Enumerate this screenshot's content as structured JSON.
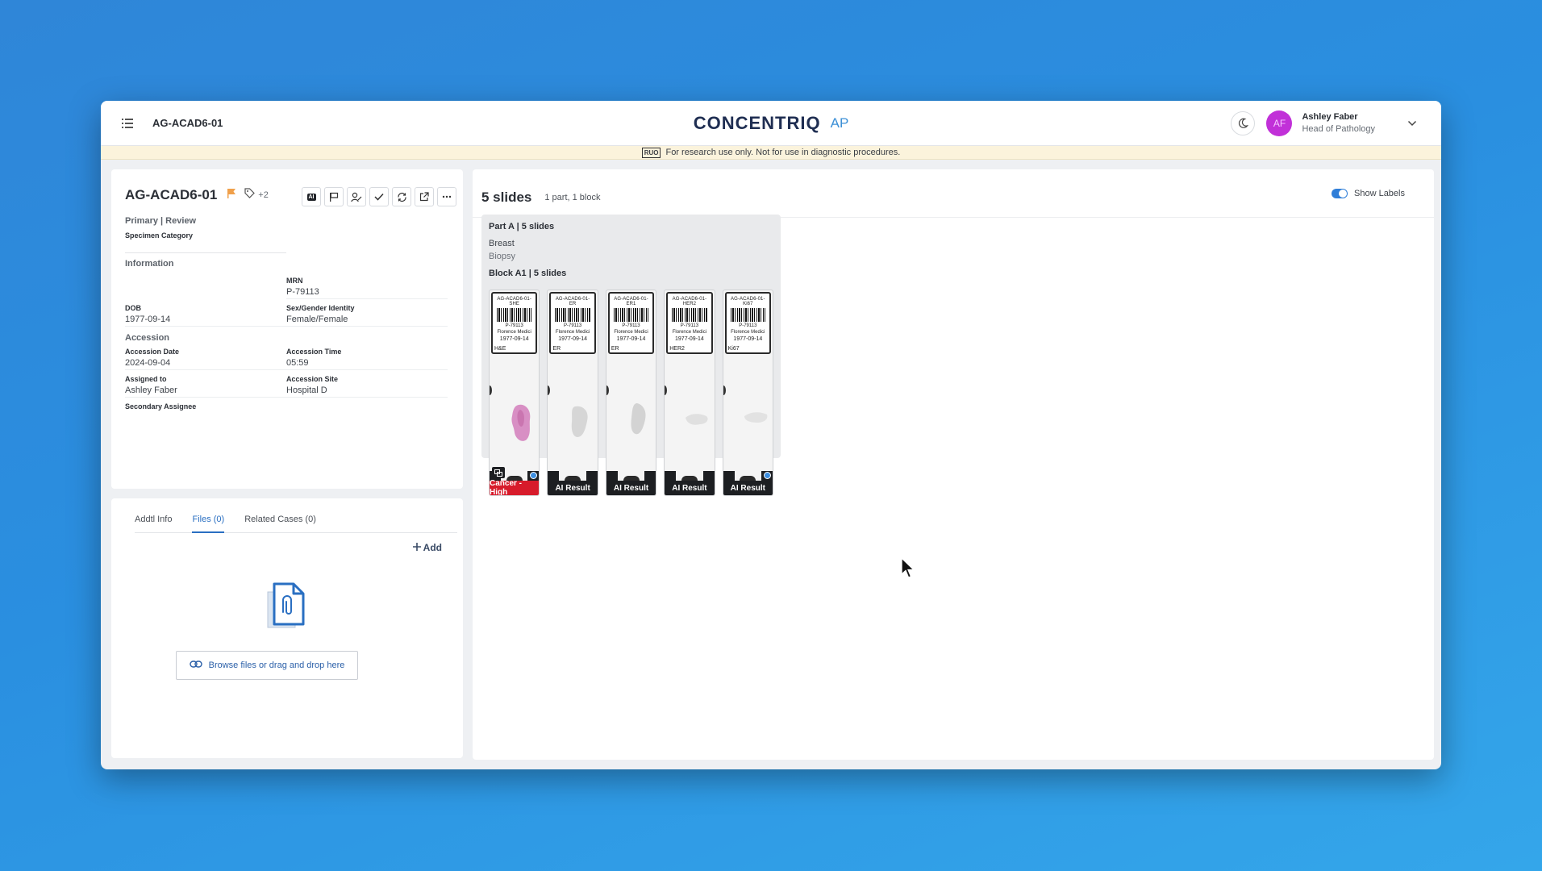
{
  "topbar": {
    "case_title": "AG-ACAD6-01",
    "logo_text": "CONCENTRIQ",
    "logo_suffix": "AP",
    "user_initials": "AF",
    "user_name": "Ashley Faber",
    "user_role": "Head of Pathology"
  },
  "banner": {
    "badge": "RUO",
    "text": "For research use only. Not for use in diagnostic procedures."
  },
  "case": {
    "id": "AG-ACAD6-01",
    "tag_count": "+2",
    "ai_badge": "AI",
    "status": "Primary | Review",
    "specimen_category_label": "Specimen Category",
    "information_title": "Information",
    "mrn_label": "MRN",
    "mrn": "P-79113",
    "dob_label": "DOB",
    "dob": "1977-09-14",
    "sex_label": "Sex/Gender Identity",
    "sex": "Female/Female",
    "accession_title": "Accession",
    "accession_date_label": "Accession Date",
    "accession_date": "2024-09-04",
    "accession_time_label": "Accession Time",
    "accession_time": "05:59",
    "assigned_label": "Assigned to",
    "assigned": "Ashley Faber",
    "site_label": "Accession Site",
    "site": "Hospital D",
    "secondary_label": "Secondary Assignee"
  },
  "files": {
    "tabs": [
      {
        "label": "Addtl Info"
      },
      {
        "label": "Files (0)"
      },
      {
        "label": "Related Cases (0)"
      }
    ],
    "active_tab": "Files (0)",
    "add_label": "Add",
    "browse_label": "Browse files or drag and drop here"
  },
  "slides": {
    "count_title": "5 slides",
    "summary": "1 part,  1 block",
    "show_labels": "Show Labels",
    "show_labels_on": true,
    "part_title": "Part A | 5 slides",
    "organ": "Breast",
    "procedure": "Biopsy",
    "block_title": "Block A1 | 5 slides",
    "items": [
      {
        "label_id": "AG-ACAD6-01-SHE",
        "mrn": "P-79113",
        "name": "Florence Medici",
        "dob": "1977-09-14",
        "stain": "H&E",
        "result": "Cancer - High",
        "result_color": "#d71b2b"
      },
      {
        "label_id": "AG-ACAD6-01-ER",
        "mrn": "P-79113",
        "name": "Florence Medici",
        "dob": "1977-09-14",
        "stain": "ER",
        "result": "AI Result",
        "result_color": "#1d1f22"
      },
      {
        "label_id": "AG-ACAD6-01-ER1",
        "mrn": "P-79113",
        "name": "Florence Medici",
        "dob": "1977-09-14",
        "stain": "ER",
        "result": "AI Result",
        "result_color": "#1d1f22"
      },
      {
        "label_id": "AG-ACAD6-01-HER2",
        "mrn": "P-79113",
        "name": "Florence Medici",
        "dob": "1977-09-14",
        "stain": "HER2",
        "result": "AI Result",
        "result_color": "#1d1f22"
      },
      {
        "label_id": "AG-ACAD6-01-Ki67",
        "mrn": "P-79113",
        "name": "Florence Medici",
        "dob": "1977-09-14",
        "stain": "Ki67",
        "result": "AI Result",
        "result_color": "#1d1f22"
      }
    ]
  },
  "colors": {
    "accent": "#2f7ed8",
    "flag": "#f0a04b",
    "avatar": "#c130d8",
    "cancer_high": "#d71b2b"
  },
  "icons": [
    "list-menu-icon",
    "moon-icon",
    "chevron-down-icon",
    "flag-icon",
    "tag-icon",
    "ai-icon",
    "flag-alt-icon",
    "assign-user-icon",
    "check-icon",
    "sync-icon",
    "external-link-icon",
    "more-icon",
    "plus-icon",
    "file-attachment-icon",
    "link-icon",
    "cursor-icon"
  ]
}
